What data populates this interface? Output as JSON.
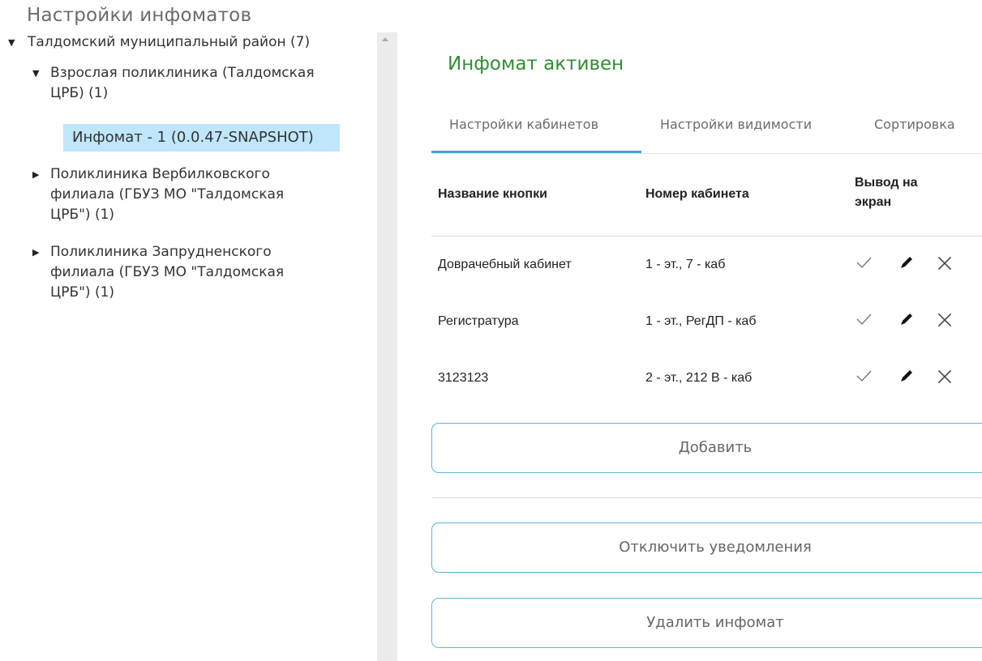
{
  "page": {
    "title": "Настройки инфоматов"
  },
  "tree": {
    "root": {
      "label": "Талдомский муниципальный район (7)",
      "expanded": true
    },
    "clinic_adult": {
      "label_line1": "Взрослая поликлиника (Талдомская",
      "label_line2": "ЦРБ) (1)",
      "expanded": true
    },
    "selected_infomat": {
      "label": "Инфомат - 1 (0.0.47-SNAPSHOT)"
    },
    "clinic_verbilki": {
      "label_line1": "Поликлиника Вербилковского",
      "label_line2": "филиала (ГБУЗ МО \"Талдомская",
      "label_line3": "ЦРБ\") (1)",
      "expanded": false
    },
    "clinic_zaprudnya": {
      "label_line1": "Поликлиника Запрудненского",
      "label_line2": "филиала (ГБУЗ МО \"Талдомская",
      "label_line3": "ЦРБ\") (1)",
      "expanded": false
    }
  },
  "status": {
    "text": "Инфомат активен",
    "color": "#2f8f2f"
  },
  "tabs": [
    {
      "label": "Настройки кабинетов",
      "active": true
    },
    {
      "label": "Настройки видимости",
      "active": false
    },
    {
      "label": "Сортировка",
      "active": false
    }
  ],
  "table": {
    "headers": {
      "button_name": "Название кнопки",
      "cabinet_number": "Номер кабинета",
      "display_line1": "Вывод на",
      "display_line2": "экран"
    },
    "rows": [
      {
        "name": "Доврачебный кабинет",
        "cabinet": "1 - эт., 7 - каб"
      },
      {
        "name": "Регистратура",
        "cabinet": "1 - эт., РегДП - каб"
      },
      {
        "name": "3123123",
        "cabinet": "2 - эт., 212 В - каб"
      }
    ]
  },
  "buttons": {
    "add": "Добавить",
    "disable_notifications": "Отключить уведомления",
    "delete_infomat": "Удалить инфомат"
  },
  "colors": {
    "accent": "#4aa3cc",
    "button_border": "#5bb6d6",
    "selected_bg": "#bfe6fb"
  },
  "icons": {
    "row_actions": [
      "check-icon",
      "pencil-icon",
      "close-icon"
    ]
  }
}
